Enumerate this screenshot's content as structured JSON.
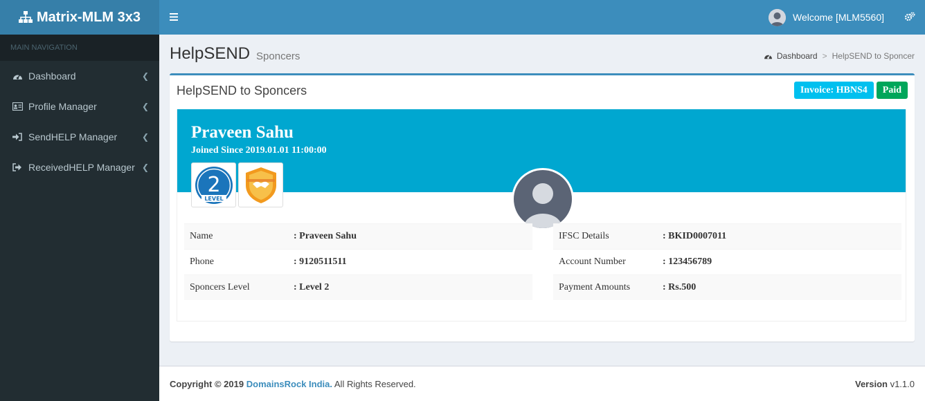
{
  "app": {
    "logo_text": "Matrix-MLM 3x3",
    "logo_icon": "sitemap-icon"
  },
  "sidebar": {
    "header": "MAIN NAVIGATION",
    "items": [
      {
        "label": "Dashboard",
        "icon": "dashboard-icon"
      },
      {
        "label": "Profile Manager",
        "icon": "id-card-icon"
      },
      {
        "label": "SendHELP Manager",
        "icon": "sign-in-icon"
      },
      {
        "label": "ReceivedHELP Manager",
        "icon": "sign-out-icon"
      }
    ]
  },
  "topbar": {
    "welcome": "Welcome [MLM5560]"
  },
  "page": {
    "title": "HelpSEND",
    "subtitle": "Sponcers"
  },
  "breadcrumb": {
    "home": "Dashboard",
    "separator": ">",
    "current": "HelpSEND to Sponcer"
  },
  "box": {
    "title": "HelpSEND to Sponcers",
    "invoice_label": "Invoice: HBNS4",
    "status_label": "Paid"
  },
  "profile": {
    "name": "Praveen Sahu",
    "joined": "Joined Since 2019.01.01 11:00:00",
    "level_badge_number": "2",
    "level_badge_text": "LEVEL"
  },
  "details_left": [
    {
      "key": "Name",
      "value": ": Praveen Sahu"
    },
    {
      "key": "Phone",
      "value": ": 9120511511"
    },
    {
      "key": "Sponcers Level",
      "value": ": Level 2"
    }
  ],
  "details_right": [
    {
      "key": "IFSC Details",
      "value": ": BKID0007011"
    },
    {
      "key": "Account Number",
      "value": ": 123456789"
    },
    {
      "key": "Payment Amounts",
      "value": ": Rs.500"
    }
  ],
  "footer": {
    "copyright": "Copyright © 2019",
    "company": "DomainsRock India.",
    "rights": "All Rights Reserved.",
    "version_label": "Version",
    "version": "v1.1.0"
  },
  "colors": {
    "header_blue": "#3c8dbc",
    "logo_blue": "#367fa9",
    "sidebar_dark": "#222d32",
    "widget_blue": "#00a7d0",
    "info": "#00c0ef",
    "success": "#00a65a"
  }
}
